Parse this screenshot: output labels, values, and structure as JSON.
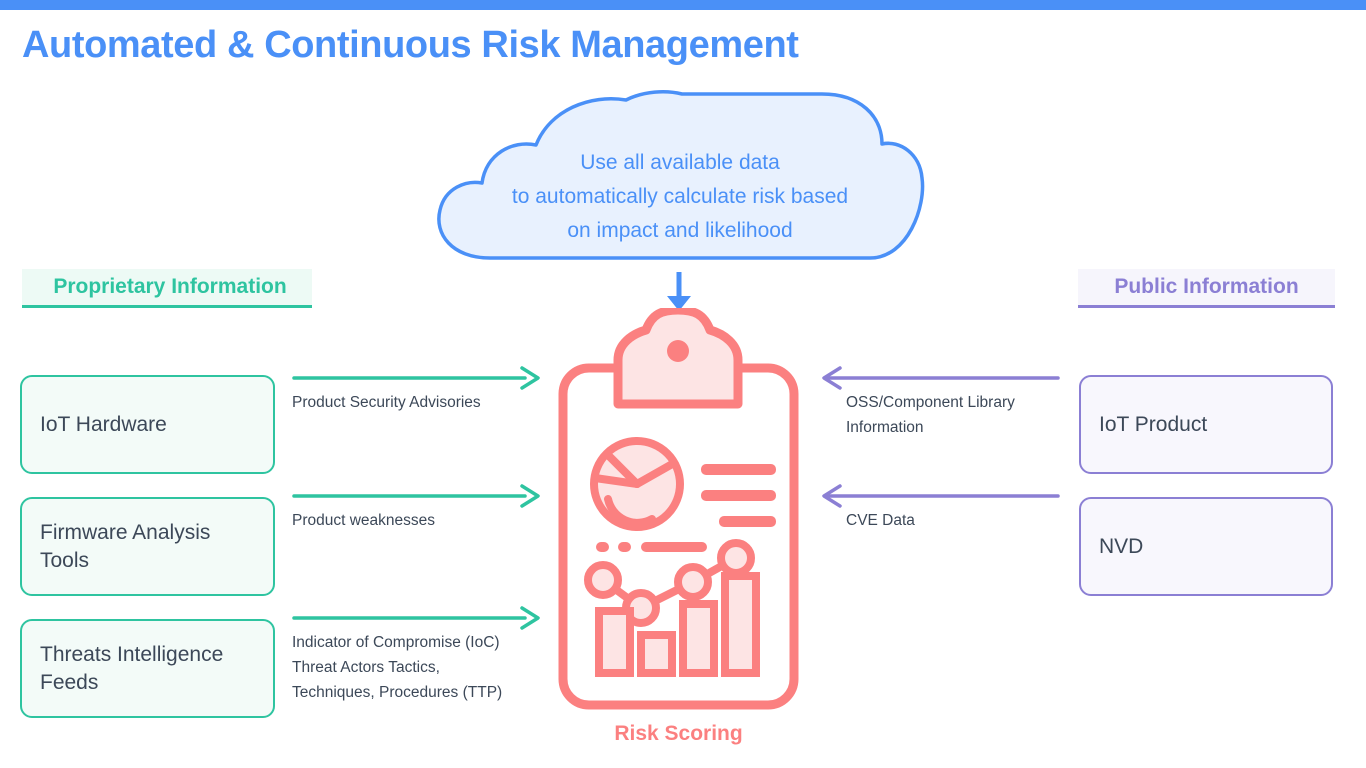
{
  "page": {
    "title": "Automated & Continuous Risk Management",
    "accent_bar_color": "#4a90f7"
  },
  "colors": {
    "blue": "#4a90f7",
    "cloud_fill": "#e8f1fe",
    "green": "#2ec4a0",
    "green_fill": "#f3fbf8",
    "green_band_fill": "#edfaf5",
    "purple": "#8b7fd4",
    "purple_fill": "#f8f7fd",
    "purple_band_fill": "#f6f5fc",
    "coral": "#fb8080",
    "coral_fill": "#fde4e4",
    "text": "#3c4858"
  },
  "cloud": {
    "name": "annotation-cloud",
    "lines": [
      "Use all available data",
      "to automatically calculate risk based",
      "on impact and likelihood"
    ]
  },
  "left_section": {
    "heading": "Proprietary Information",
    "boxes": [
      {
        "label": "IoT Hardware"
      },
      {
        "label": "Firmware Analysis Tools"
      },
      {
        "label": "Threats Intelligence Feeds"
      }
    ],
    "flows": [
      {
        "lines": [
          "Product Security Advisories"
        ]
      },
      {
        "lines": [
          "Product weaknesses"
        ]
      },
      {
        "lines": [
          "Indicator of Compromise (IoC)",
          "Threat Actors Tactics,",
          "Techniques, Procedures (TTP)"
        ]
      }
    ]
  },
  "right_section": {
    "heading": "Public Information",
    "boxes": [
      {
        "label": "IoT Product"
      },
      {
        "label": "NVD"
      }
    ],
    "flows": [
      {
        "lines": [
          "OSS/Component Library",
          "Information"
        ]
      },
      {
        "lines": [
          "CVE Data"
        ]
      }
    ]
  },
  "center": {
    "icon_name": "clipboard-risk-report-icon",
    "caption": "Risk Scoring"
  }
}
